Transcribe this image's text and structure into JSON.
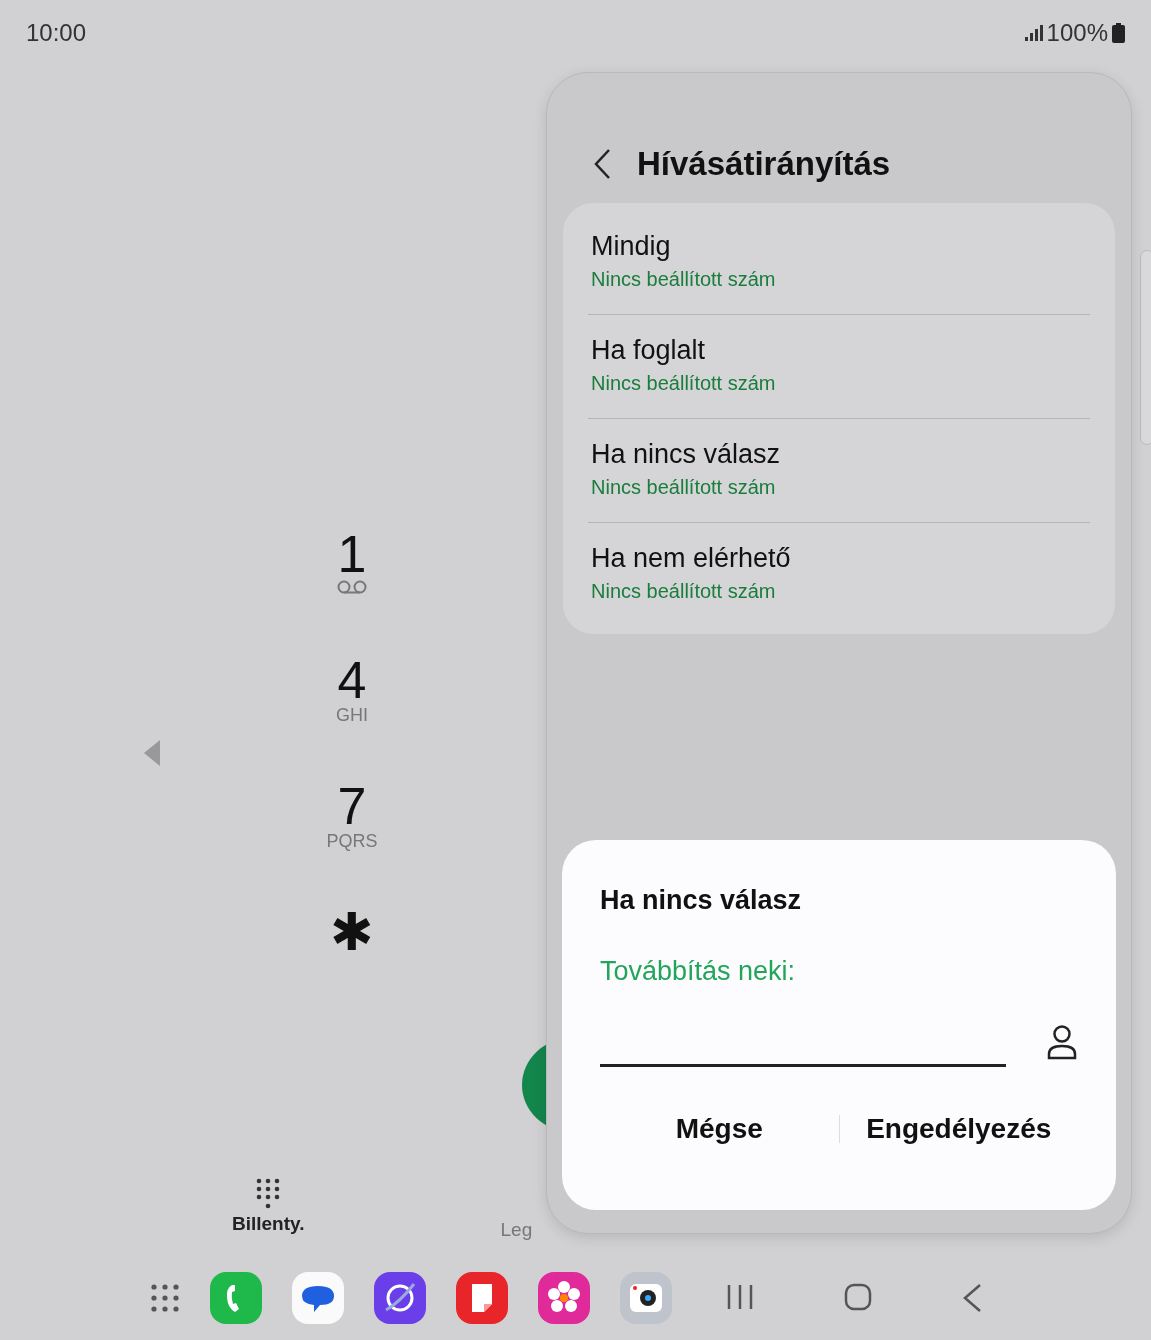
{
  "status_bar": {
    "time": "10:00",
    "battery": "100%"
  },
  "keypad": [
    {
      "digit": "1",
      "kind": "voicemail"
    },
    {
      "digit": "4",
      "kind": "letters",
      "letters": "GHI"
    },
    {
      "digit": "7",
      "kind": "letters",
      "letters": "PQRS"
    },
    {
      "digit": "✱",
      "kind": "plain"
    }
  ],
  "bottom_tabs": [
    {
      "label": "Billenty.",
      "selected": true
    },
    {
      "label": "Leg",
      "selected": false
    }
  ],
  "settings_panel": {
    "title": "Hívásátirányítás",
    "items": [
      {
        "title": "Mindig",
        "subtitle": "Nincs beállított szám"
      },
      {
        "title": "Ha foglalt",
        "subtitle": "Nincs beállított szám"
      },
      {
        "title": "Ha nincs válasz",
        "subtitle": "Nincs beállított szám"
      },
      {
        "title": "Ha nem elérhető",
        "subtitle": "Nincs beállított szám"
      }
    ]
  },
  "dialog": {
    "title": "Ha nincs válasz",
    "label": "Továbbítás neki:",
    "buttons": [
      "Mégse",
      "Engedélyezés"
    ]
  },
  "taskbar": {
    "apps": [
      {
        "kind": "phone"
      },
      {
        "kind": "messages"
      },
      {
        "kind": "browser"
      },
      {
        "kind": "notes"
      },
      {
        "kind": "gallery"
      },
      {
        "kind": "camera"
      }
    ]
  }
}
